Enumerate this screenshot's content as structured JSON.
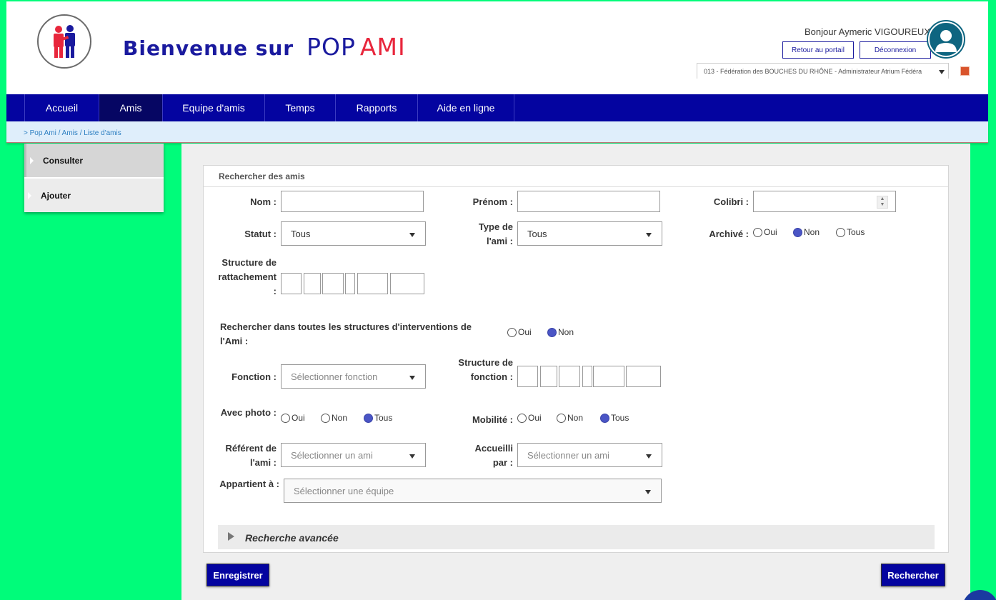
{
  "header": {
    "welcome": "Bienvenue sur",
    "brand_pop": "POP",
    "brand_ami": "AMI",
    "greeting": "Bonjour Aymeric VIGOUREUX",
    "portal_button": "Retour au portail",
    "logout_button": "Déconnexion",
    "federation_select": "013 - Fédération des BOUCHES DU RHÔNE - Administrateur Atrium Fédéra"
  },
  "nav": {
    "items": [
      {
        "label": "Accueil"
      },
      {
        "label": "Amis"
      },
      {
        "label": "Equipe d'amis"
      },
      {
        "label": "Temps"
      },
      {
        "label": "Rapports"
      },
      {
        "label": "Aide en ligne"
      }
    ],
    "active": "Amis"
  },
  "breadcrumb": {
    "prefix": ">",
    "items": [
      "Pop Ami",
      "Amis",
      "Liste d'amis"
    ],
    "separator": "/"
  },
  "sidebar": {
    "items": [
      {
        "label": "Consulter"
      },
      {
        "label": "Ajouter"
      }
    ]
  },
  "search": {
    "title": "Rechercher des amis",
    "nom_label": "Nom :",
    "prenom_label": "Prénom :",
    "colibri_label": "Colibri :",
    "statut_label": "Statut :",
    "statut_value": "Tous",
    "type_label": "Type de l'ami :",
    "type_value": "Tous",
    "archive_label": "Archivé :",
    "archive_options": [
      "Oui",
      "Non",
      "Tous"
    ],
    "archive_selected": "Non",
    "structure_label": "Structure de rattachement :",
    "interventions_label": "Rechercher dans toutes les structures d'interventions de l'Ami :",
    "interventions_options": [
      "Oui",
      "Non"
    ],
    "interventions_selected": "Non",
    "fonction_label": "Fonction :",
    "fonction_placeholder": "Sélectionner fonction",
    "structure_fonction_label": "Structure de fonction :",
    "photo_label": "Avec photo :",
    "photo_options": [
      "Oui",
      "Non",
      "Tous"
    ],
    "photo_selected": "Tous",
    "mobilite_label": "Mobilité :",
    "mobilite_options": [
      "Oui",
      "Non",
      "Tous"
    ],
    "mobilite_selected": "Tous",
    "referent_label": "Référent de l'ami :",
    "referent_placeholder": "Sélectionner un ami",
    "accueilli_label": "Accueilli par :",
    "accueilli_placeholder": "Sélectionner un ami",
    "appartient_label": "Appartient à :",
    "appartient_placeholder": "Sélectionner une équipe",
    "advanced_label": "Recherche avancée"
  },
  "actions": {
    "save": "Enregistrer",
    "search": "Rechercher"
  },
  "colors": {
    "nav": "#0404a0",
    "nav_active": "#060663",
    "brand_red": "#e8263c",
    "background": "#00fc7a",
    "radio_on": "#4a55c5"
  }
}
